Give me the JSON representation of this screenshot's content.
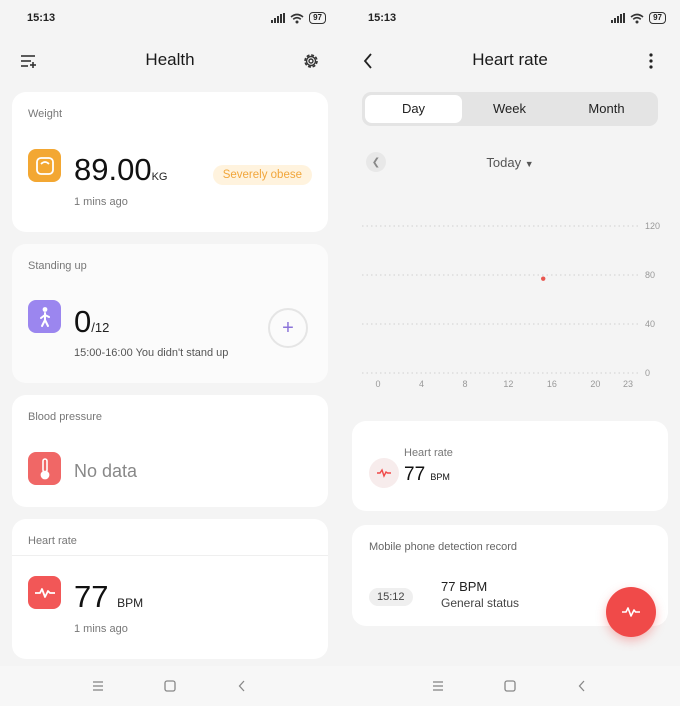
{
  "left": {
    "status": {
      "time": "15:13",
      "battery": "97"
    },
    "appbar": {
      "title": "Health"
    },
    "weight": {
      "label": "Weight",
      "value": "89.00",
      "unit": "KG",
      "badge": "Severely obese",
      "updated": "1 mins ago"
    },
    "standing": {
      "label": "Standing up",
      "value": "0",
      "goal": "/12",
      "detail": "15:00-16:00  You didn't stand up"
    },
    "blood_pressure": {
      "label": "Blood pressure",
      "value": "No data"
    },
    "heart_rate": {
      "label": "Heart rate",
      "value": "77",
      "unit": "BPM",
      "updated": "1 mins ago"
    }
  },
  "right": {
    "status": {
      "time": "15:13",
      "battery": "97"
    },
    "appbar": {
      "title": "Heart rate"
    },
    "tabs": [
      {
        "label": "Day",
        "active": true
      },
      {
        "label": "Week",
        "active": false
      },
      {
        "label": "Month",
        "active": false
      }
    ],
    "date": {
      "label": "Today"
    },
    "summary": {
      "label": "Heart rate",
      "value": "77",
      "unit": "BPM"
    },
    "record": {
      "title": "Mobile phone detection record",
      "time": "15:12",
      "value": "77 BPM",
      "status": "General status"
    }
  },
  "chart_data": {
    "type": "scatter",
    "x_ticks": [
      "0",
      "4",
      "8",
      "12",
      "16",
      "20",
      "23"
    ],
    "y_ticks": [
      "120",
      "80",
      "40",
      "0"
    ],
    "xlim": [
      0,
      23
    ],
    "ylim": [
      0,
      120
    ],
    "points": [
      {
        "x": 15.2,
        "y": 77
      }
    ],
    "grid": true,
    "color": "#e8564f"
  },
  "colors": {
    "weight": "#f3a732",
    "standing": "#9b86ef",
    "blood_pressure": "#f06766",
    "heart": "#f25757",
    "accent": "#f04a49"
  }
}
